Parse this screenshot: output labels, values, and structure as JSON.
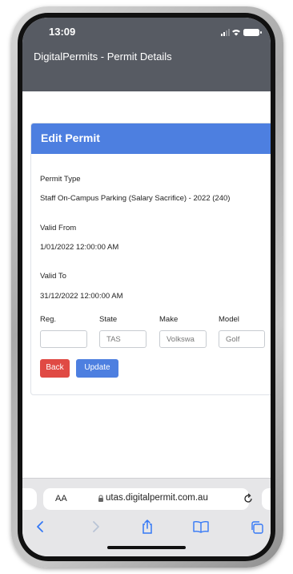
{
  "status_bar": {
    "time": "13:09"
  },
  "app_bar": {
    "title": "DigitalPermits - Permit Details"
  },
  "card": {
    "title": "Edit Permit",
    "permit_type_label": "Permit Type",
    "permit_type_value": "Staff On-Campus Parking (Salary Sacrifice) - 2022 (240)",
    "valid_from_label": "Valid From",
    "valid_from_value": "1/01/2022 12:00:00 AM",
    "valid_to_label": "Valid To",
    "valid_to_value": "31/12/2022 12:00:00 AM",
    "fields": {
      "reg_label": "Reg.",
      "reg_value": "",
      "state_label": "State",
      "state_value": "TAS",
      "make_label": "Make",
      "make_value": "Volkswa",
      "model_label": "Model",
      "model_value": "Golf"
    },
    "back_button": "Back",
    "update_button": "Update"
  },
  "browser": {
    "aa_label": "AA",
    "url": "utas.digitalpermit.com.au"
  },
  "colors": {
    "header_blue": "#4d7fe0",
    "back_red": "#e04a44",
    "update_blue": "#4d7fe0",
    "app_bar_gray": "#575b63",
    "safari_blue": "#3478f6"
  }
}
